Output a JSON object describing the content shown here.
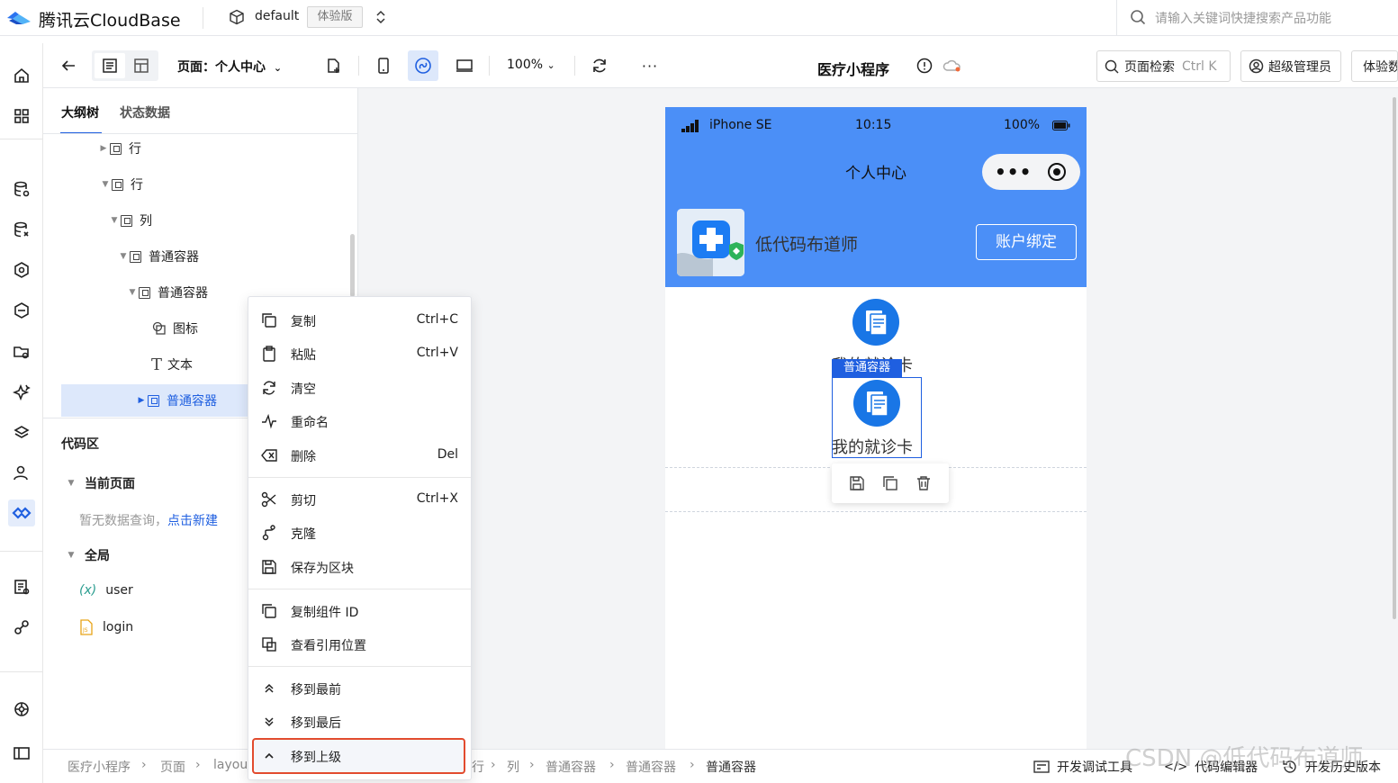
{
  "topbar": {
    "brand": "腾讯云CloudBase",
    "env_name": "default",
    "env_badge": "体验版",
    "search_placeholder": "请输入关键词快捷搜索产品功能"
  },
  "toolbar": {
    "page_select": "页面：个人中心",
    "zoom": "100%",
    "app_title": "医疗小程序",
    "page_search": "页面检索",
    "page_search_shortcut": "Ctrl K",
    "admin": "超级管理员",
    "trial": "体验数"
  },
  "panel": {
    "tabs": [
      "大纲树",
      "状态数据"
    ],
    "tree": [
      {
        "label": "行",
        "expanded": false
      },
      {
        "label": "行",
        "expanded": true
      },
      {
        "label": "列",
        "expanded": true
      },
      {
        "label": "普通容器",
        "expanded": true
      },
      {
        "label": "普通容器",
        "expanded": true
      },
      {
        "label": "图标",
        "icon": "icon-node"
      },
      {
        "label": "文本",
        "icon": "text-node"
      },
      {
        "label": "普通容器",
        "selected": true,
        "expanded": false
      }
    ],
    "code_header": "代码区",
    "current_page": "当前页面",
    "empty_query": "暂无数据查询，",
    "create_new": "点击新建",
    "global": "全局",
    "vars": [
      {
        "prefix": "(x)",
        "name": "user"
      },
      {
        "name": "login"
      }
    ]
  },
  "phone": {
    "carrier": "iPhone SE",
    "time": "10:15",
    "battery": "100%",
    "nav_title": "个人中心",
    "user_name": "低代码布道师",
    "bind_button": "账户绑定",
    "card_label": "我的就诊卡",
    "selected_tag": "普通容器"
  },
  "context_menu": {
    "groups": [
      [
        {
          "label": "复制",
          "shortcut": "Ctrl+C",
          "icon": "copy-icon"
        },
        {
          "label": "粘贴",
          "shortcut": "Ctrl+V",
          "icon": "paste-icon"
        },
        {
          "label": "清空",
          "icon": "clear-icon"
        },
        {
          "label": "重命名",
          "icon": "rename-icon"
        },
        {
          "label": "删除",
          "shortcut": "Del",
          "icon": "delete-icon"
        }
      ],
      [
        {
          "label": "剪切",
          "shortcut": "Ctrl+X",
          "icon": "cut-icon"
        },
        {
          "label": "克隆",
          "icon": "clone-icon"
        },
        {
          "label": "保存为区块",
          "icon": "save-icon"
        }
      ],
      [
        {
          "label": "复制组件 ID",
          "icon": "copy-id-icon"
        },
        {
          "label": "查看引用位置",
          "icon": "reference-icon"
        }
      ],
      [
        {
          "label": "移到最前",
          "icon": "move-top-icon"
        },
        {
          "label": "移到最后",
          "icon": "move-bottom-icon"
        },
        {
          "label": "移到上级",
          "icon": "move-up-icon",
          "highlighted": true
        }
      ]
    ]
  },
  "statusbar": {
    "crumbs_left": [
      "医疗小程序",
      "页面",
      "layout"
    ],
    "crumbs_right": [
      "行",
      "列",
      "普通容器",
      "普通容器",
      "普通容器"
    ],
    "tools": [
      "开发调试工具",
      "代码编辑器",
      "开发历史版本"
    ]
  },
  "watermark": "CSDN @低代码布道师",
  "colors": {
    "accent": "#1f5fe0",
    "phone_header": "#4b8ff7",
    "highlight_border": "#e24b2e"
  }
}
